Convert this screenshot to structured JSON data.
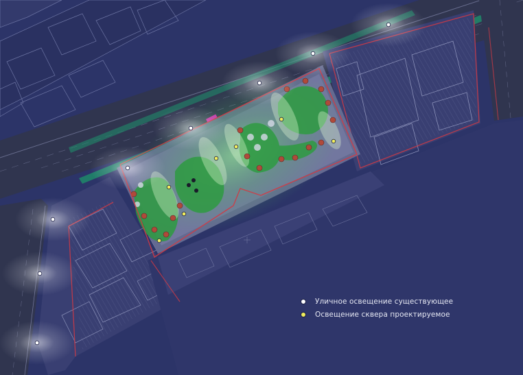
{
  "map": {
    "colors": {
      "background": "#2c3468",
      "road": "#30354f",
      "lane_marking": "#8b90b5",
      "green_strip": "#1f8a6a",
      "boundary": "#d23a44",
      "plaza": "#6a7096",
      "lawn": "#2e9b41",
      "glow": "#ffffff",
      "street_light": "#ffffff",
      "square_light": "#f2ef5c"
    },
    "icons": {
      "street_light": "white-dot-icon",
      "square_light": "yellow-dot-icon",
      "tree": "tree-circle-icon"
    },
    "legend": {
      "items": [
        {
          "label": "Уличное освещение существующее",
          "color": "#ffffff"
        },
        {
          "label": "Освещение сквера проектируемое",
          "color": "#f2ef5c"
        }
      ]
    }
  }
}
